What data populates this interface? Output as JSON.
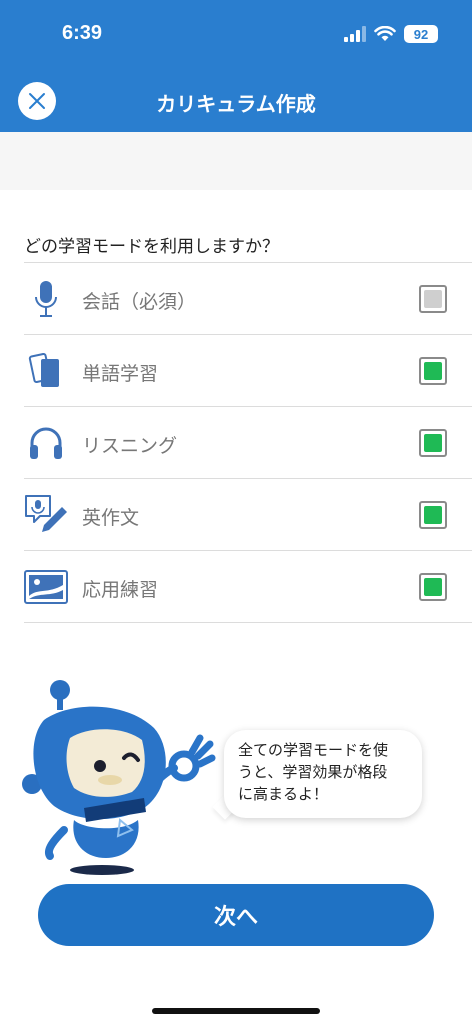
{
  "status": {
    "time": "6:39",
    "battery": "92"
  },
  "header": {
    "title": "カリキュラム作成"
  },
  "question": "どの学習モードを利用しますか？",
  "options": [
    {
      "label": "会話（必須）",
      "icon": "microphone-icon",
      "state": "disabled"
    },
    {
      "label": "単語学習",
      "icon": "cards-icon",
      "state": "checked"
    },
    {
      "label": "リスニング",
      "icon": "headphones-icon",
      "state": "checked"
    },
    {
      "label": "英作文",
      "icon": "pen-speech-icon",
      "state": "checked"
    },
    {
      "label": "応用練習",
      "icon": "picture-icon",
      "state": "checked"
    }
  ],
  "mascot": {
    "message": "全ての学習モードを使\nうと、学習効果が格段\nに高まるよ！"
  },
  "footer": {
    "next_label": "次へ"
  },
  "colors": {
    "primary": "#2a7ecf",
    "button": "#1f72c4",
    "check": "#1fba55",
    "disabled": "#cfcfcf"
  }
}
